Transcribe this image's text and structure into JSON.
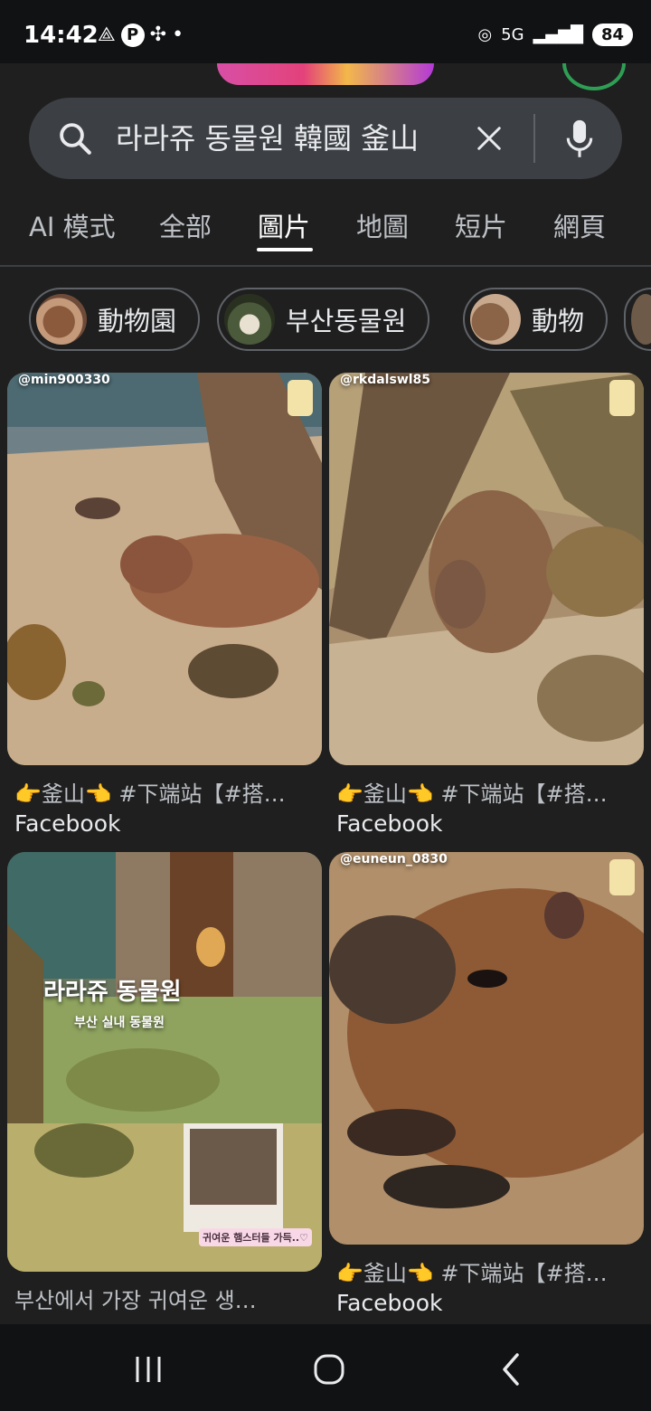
{
  "status": {
    "time": "14:42",
    "left_icons": [
      "network-icon",
      "p-badge",
      "fan-icon",
      "dot"
    ],
    "network": "5G",
    "battery": "84"
  },
  "search": {
    "query": "라라쥬 동물원 韓國 釜山"
  },
  "tabs": [
    {
      "label": "AI 模式",
      "active": false
    },
    {
      "label": "全部",
      "active": false
    },
    {
      "label": "圖片",
      "active": true
    },
    {
      "label": "地圖",
      "active": false
    },
    {
      "label": "短片",
      "active": false
    },
    {
      "label": "網頁",
      "active": false
    }
  ],
  "chips": [
    {
      "label": "動物園"
    },
    {
      "label": "부산동물원"
    },
    {
      "label": "動物"
    }
  ],
  "results": [
    {
      "title": "👉釜山👈 #下端站【#搭…",
      "source": "Facebook",
      "watermark": "@min900330"
    },
    {
      "title": "👉釜山👈 #下端站【#搭…",
      "source": "Facebook",
      "watermark": "@rkdalswl85"
    },
    {
      "title": "부산에서 가장 귀여운 생…",
      "source": "",
      "overlay_title": "라라쥬 동물원",
      "overlay_subtitle": "부산 실내 동물원",
      "overlay_caption": "귀여운 햄스터들 가득..♡"
    },
    {
      "title": "👉釜山👈 #下端站【#搭…",
      "source": "Facebook",
      "watermark": "@euneun_0830"
    }
  ],
  "colors": {
    "background": "#1f1f1f",
    "search_bg": "#3c3f43",
    "accent_active": "#ffffff"
  }
}
